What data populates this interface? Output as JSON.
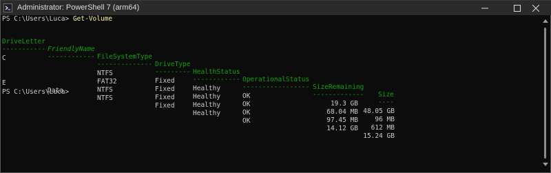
{
  "window": {
    "title": "Administrator: PowerShell 7 (arm64)"
  },
  "terminal": {
    "prompt1": "PS C:\\Users\\Luca> ",
    "command1": "Get-Volume",
    "headers": [
      "DriveLetter",
      "FriendlyName",
      "FileSystemType",
      "DriveType",
      "HealthStatus",
      "OperationalStatus",
      "SizeRemaining",
      "Size"
    ],
    "separators": [
      "-----------",
      "------------",
      "--------------",
      "---------",
      "------------",
      "-----------------",
      "-------------",
      "----"
    ],
    "rows": [
      [
        "C",
        "",
        "NTFS",
        "Fixed",
        "Healthy",
        "OK",
        "19.3 GB",
        "48.05 GB"
      ],
      [
        "",
        "",
        "FAT32",
        "Fixed",
        "Healthy",
        "OK",
        "68.04 MB",
        "96 MB"
      ],
      [
        "",
        "",
        "NTFS",
        "Fixed",
        "Healthy",
        "OK",
        "97.45 MB",
        "612 MB"
      ],
      [
        "E",
        "Data",
        "NTFS",
        "Fixed",
        "Healthy",
        "OK",
        "14.12 GB",
        "15.24 GB"
      ]
    ],
    "prompt2": "PS C:\\Users\\Luca>"
  }
}
